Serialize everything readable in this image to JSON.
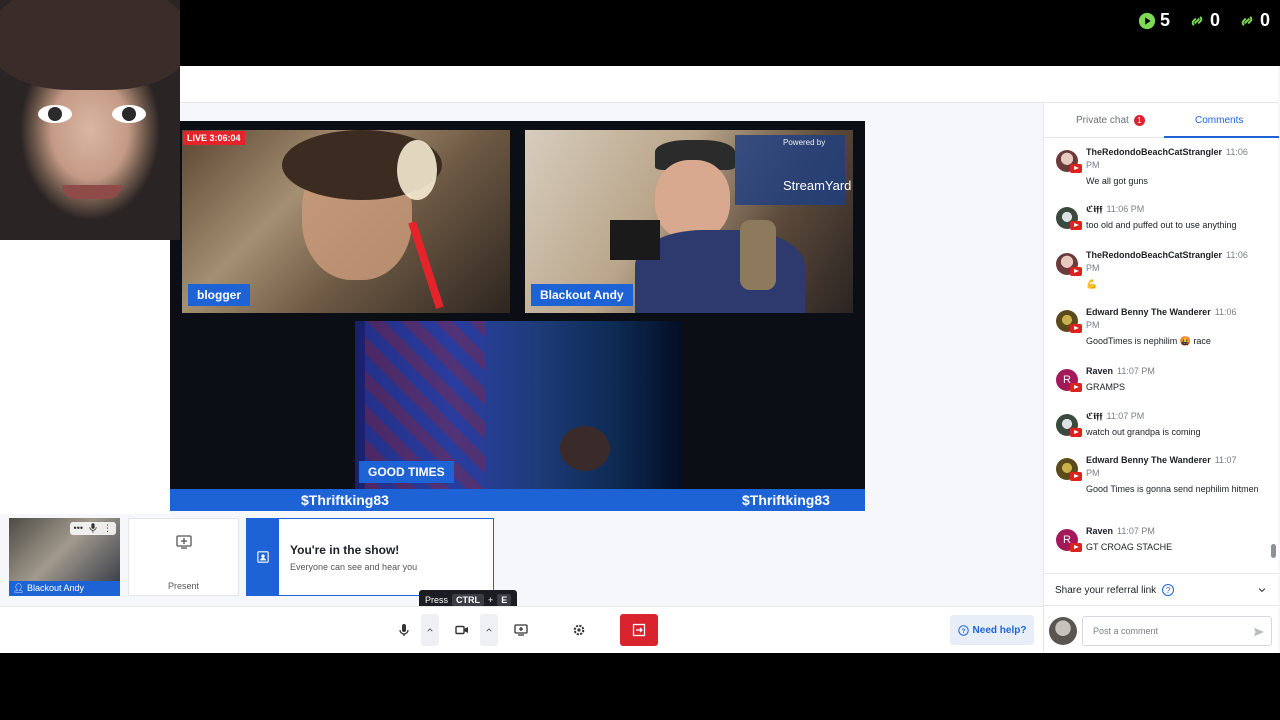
{
  "stats": [
    {
      "icon": "play-icon",
      "value": "5",
      "color": "#7ed957"
    },
    {
      "icon": "link-icon",
      "value": "0",
      "color": "#7ed957"
    },
    {
      "icon": "link-icon",
      "value": "0",
      "color": "#7ed957"
    }
  ],
  "stage": {
    "live_label": "LIVE 3:06:04",
    "participants": [
      {
        "name": "blogger"
      },
      {
        "name": "Blackout Andy"
      },
      {
        "name": "GOOD TIMES"
      }
    ],
    "banner_left": "$Thriftking83",
    "banner_right": "$Thriftking83",
    "watermark_top": "Powered by",
    "watermark": "StreamYard"
  },
  "tray": {
    "self_name": "Blackout Andy",
    "self_controls": "•••",
    "present_label": "Present",
    "show_title": "You're in the show!",
    "show_subtitle": "Everyone can see and hear you"
  },
  "tooltip": {
    "press": "Press",
    "key1": "CTRL",
    "plus": "+",
    "key2": "E"
  },
  "controls": {
    "help": "Need help?"
  },
  "panel": {
    "tab_private": "Private chat",
    "private_badge": "1",
    "tab_comments": "Comments",
    "comments": [
      {
        "author": "TheRedondoBeachCatStrangler",
        "time": "11:06",
        "time2": "PM",
        "text": "We all got guns",
        "avatar": "img1"
      },
      {
        "author": "ℭ𝖎𝖋𝖋",
        "time": "11:06 PM",
        "time2": "",
        "text": "too old and puffed out to use anything",
        "avatar": "img2"
      },
      {
        "author": "TheRedondoBeachCatStrangler",
        "time": "11:06",
        "time2": "PM",
        "text": "💪",
        "avatar": "img1"
      },
      {
        "author": "Edward Benny The Wanderer",
        "time": "11:06",
        "time2": "PM",
        "text": "GoodTimes is nephilim 🤬 race",
        "avatar": "img3"
      },
      {
        "author": "Raven",
        "time": "11:07 PM",
        "time2": "",
        "text": "GRAMPS",
        "avatar": "letter",
        "letter": "R"
      },
      {
        "author": "ℭ𝖎𝖋𝖋",
        "time": "11:07 PM",
        "time2": "",
        "text": "watch out grandpa is coming",
        "avatar": "img2"
      },
      {
        "author": "Edward Benny The Wanderer",
        "time": "11:07",
        "time2": "PM",
        "text": "Good Times is gonna send nephilim hitmen",
        "avatar": "img3"
      },
      {
        "author": "Raven",
        "time": "11:07 PM",
        "time2": "",
        "text": "GT CROAG STACHE",
        "avatar": "letter",
        "letter": "R"
      }
    ],
    "referral": "Share your referral link",
    "post_placeholder": "Post a comment"
  }
}
